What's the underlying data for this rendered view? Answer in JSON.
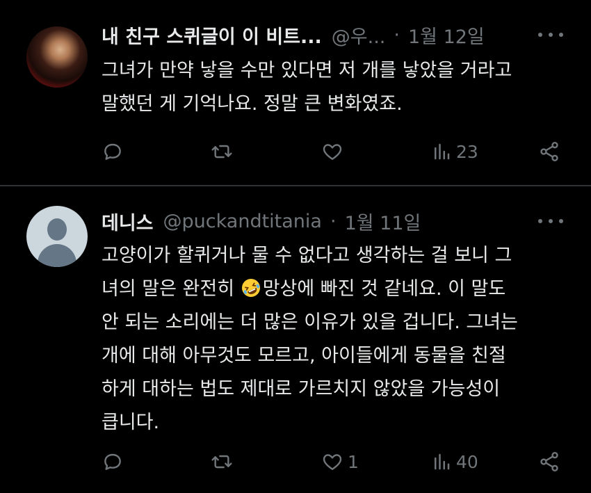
{
  "tweets": [
    {
      "display_name": "내 친구 스퀴글이 이 비트...",
      "handle": "@우...",
      "separator": "·",
      "date": "1월 12일",
      "avatar": "profile-photo",
      "text": "그녀가 만약 낳을 수만 있다면 저 개를 낳았을 거라고\n말했던 게 기억나요. 정말 큰 변화였죠.",
      "actions": {
        "reply_count": "",
        "retweet_count": "",
        "like_count": "",
        "views_count": "23"
      }
    },
    {
      "display_name": "데니스",
      "handle": "@puckandtitania",
      "separator": "·",
      "date": "1월 11일",
      "avatar": "default-profile-icon",
      "text_part1": "고양이가 할퀴거나 물 수 없다고 생각하는 걸 보니 그\n녀의 말은 완전히 ",
      "emoji": "rolling-on-floor-laughing-emoji",
      "text_part2": "망상에 빠진 것 같네요. 이 말도\n안 되는 소리에는 더 많은 이유가 있을 겁니다. 그녀는\n개에 대해 아무것도 모르고, 아이들에게 동물을 친절\n하게 대하는 법도 제대로 가르치지 않았을 가능성이\n큽니다.",
      "actions": {
        "reply_count": "",
        "retweet_count": "",
        "like_count": "1",
        "views_count": "40"
      }
    }
  ],
  "colors": {
    "background": "#000000",
    "text_primary": "#e7e9ea",
    "text_secondary": "#71767b",
    "separator": "#2f3336"
  },
  "icons": [
    "reply-icon",
    "retweet-icon",
    "like-icon",
    "views-icon",
    "share-icon",
    "more-icon"
  ]
}
